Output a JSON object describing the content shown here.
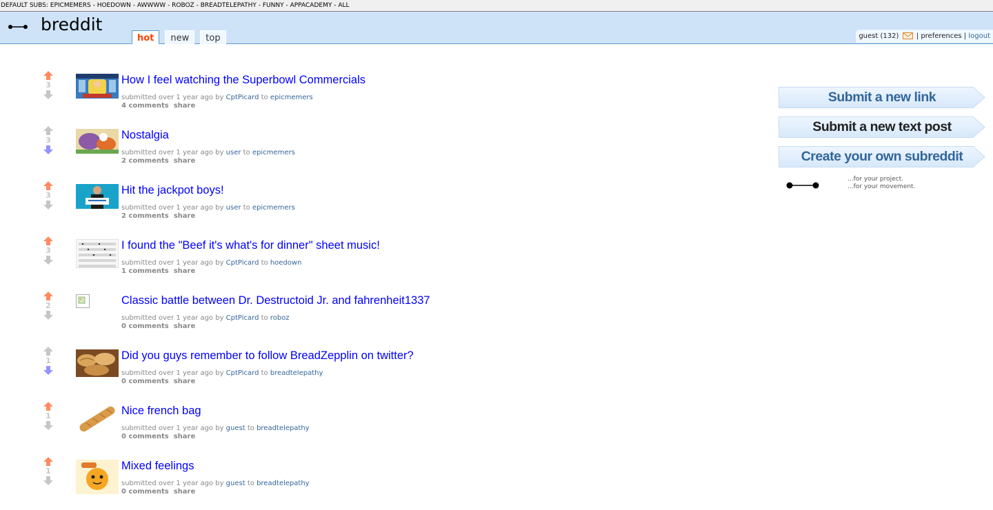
{
  "sr_bar": {
    "prefix": "DEFAULT SUBS:",
    "subs": [
      "epicmemers",
      "hoedown",
      "awwww",
      "roboz",
      "breadtelepathy",
      "funny",
      "appacademy",
      "all"
    ]
  },
  "header": {
    "site_name": "breddit",
    "tabs": [
      "hot",
      "new",
      "top"
    ],
    "user": "guest",
    "karma": "(132)",
    "preferences": "preferences",
    "logout": "logout",
    "sep": "|"
  },
  "posts": [
    {
      "score": "3",
      "title": "How I feel watching the Superbowl Commercials",
      "submitted": "submitted over 1 year ago by",
      "author": "CptPicard",
      "to": "to",
      "subreddit": "epicmemers",
      "comments": "4 comments",
      "share": "share",
      "vote": "up",
      "thumb": "cartoon-meme"
    },
    {
      "score": "3",
      "title": "Nostalgia",
      "submitted": "submitted over 1 year ago by",
      "author": "user",
      "to": "to",
      "subreddit": "epicmemers",
      "comments": "2 comments",
      "share": "share",
      "vote": "down",
      "thumb": "cartoon-scene"
    },
    {
      "score": "3",
      "title": "Hit the jackpot boys!",
      "submitted": "submitted over 1 year ago by",
      "author": "user",
      "to": "to",
      "subreddit": "epicmemers",
      "comments": "2 comments",
      "share": "share",
      "vote": "up",
      "thumb": "man-sign"
    },
    {
      "score": "3",
      "title": "I found the \"Beef it's what's for dinner\" sheet music!",
      "submitted": "submitted over 1 year ago by",
      "author": "CptPicard",
      "to": "to",
      "subreddit": "hoedown",
      "comments": "1 comments",
      "share": "share",
      "vote": "up",
      "thumb": "sheet-music"
    },
    {
      "score": "2",
      "title": "Classic battle between Dr. Destructoid Jr. and fahrenheit1337",
      "submitted": "submitted over 1 year ago by",
      "author": "CptPicard",
      "to": "to",
      "subreddit": "roboz",
      "comments": "0 comments",
      "share": "share",
      "vote": "up",
      "thumb": "broken-image"
    },
    {
      "score": "1",
      "title": "Did you guys remember to follow BreadZepplin on twitter?",
      "submitted": "submitted over 1 year ago by",
      "author": "CptPicard",
      "to": "to",
      "subreddit": "breadtelepathy",
      "comments": "0 comments",
      "share": "share",
      "vote": "down",
      "thumb": "bread-loaves"
    },
    {
      "score": "1",
      "title": "Nice french bag",
      "submitted": "submitted over 1 year ago by",
      "author": "guest",
      "to": "to",
      "subreddit": "breadtelepathy",
      "comments": "0 comments",
      "share": "share",
      "vote": "up",
      "thumb": "baguette"
    },
    {
      "score": "1",
      "title": "Mixed feelings",
      "submitted": "submitted over 1 year ago by",
      "author": "guest",
      "to": "to",
      "subreddit": "breadtelepathy",
      "comments": "0 comments",
      "share": "share",
      "vote": "up",
      "thumb": "cartoon-bread"
    }
  ],
  "sidebar": {
    "submit_link": "Submit a new link",
    "submit_text": "Submit a new text post",
    "create_subreddit": "Create your own subreddit",
    "tagline_1": "...for your project.",
    "tagline_2": "...for your movement."
  },
  "colors": {
    "header_bg": "#cee3f8",
    "link_blue": "#0000ff",
    "upvote": "#ff8b60",
    "downvote": "#9494ff",
    "neutral_arrow": "#c6c6c6",
    "tab_selected": "#ff4500"
  }
}
